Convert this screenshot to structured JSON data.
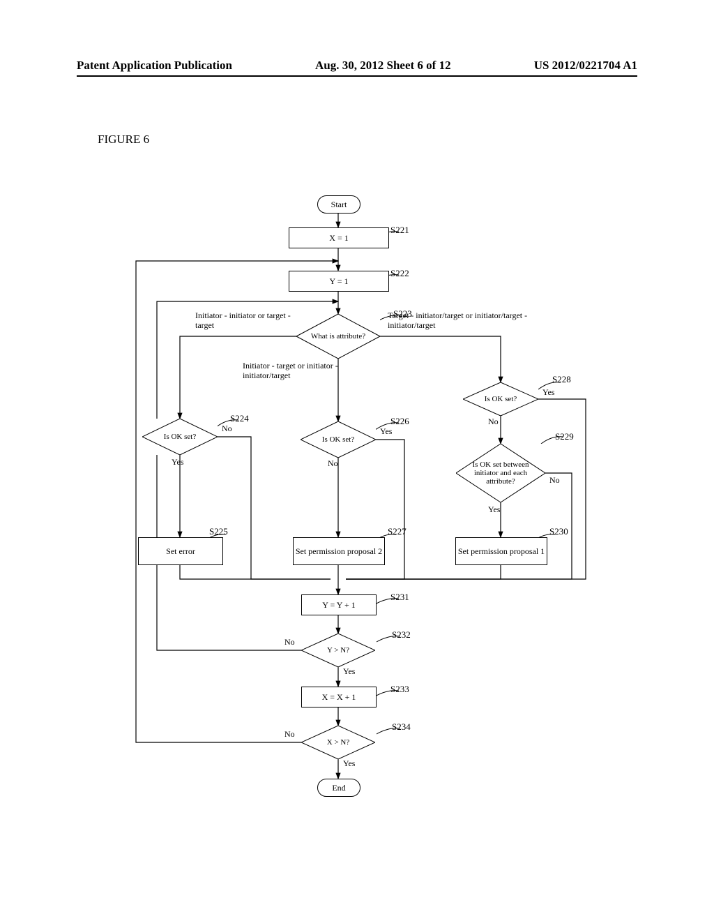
{
  "header": {
    "left": "Patent Application Publication",
    "center": "Aug. 30, 2012  Sheet 6 of 12",
    "right": "US 2012/0221704 A1"
  },
  "figure_label": "FIGURE 6",
  "terminals": {
    "start": "Start",
    "end": "End"
  },
  "processes": {
    "s221": "X = 1",
    "s222": "Y = 1",
    "s225": "Set error",
    "s227": "Set permission proposal 2",
    "s230": "Set permission proposal 1",
    "s231": "Y = Y + 1",
    "s233": "X = X + 1"
  },
  "decisions": {
    "s223": "What is attribute?",
    "s224": "Is OK set?",
    "s226": "Is OK set?",
    "s228": "Is OK set?",
    "s229": "Is OK set between initiator and each attribute?",
    "s232": "Y > N?",
    "s234": "X > N?"
  },
  "step_labels": {
    "s221": "S221",
    "s222": "S222",
    "s223": "S223",
    "s224": "S224",
    "s225": "S225",
    "s226": "S226",
    "s227": "S227",
    "s228": "S228",
    "s229": "S229",
    "s230": "S230",
    "s231": "S231",
    "s232": "S232",
    "s233": "S233",
    "s234": "S234"
  },
  "branch_texts": {
    "s223_left": "Initiator - initiator\nor target - target",
    "s223_right": "Target - initiator/target or\ninitiator/target - initiator/target",
    "s223_down": "Initiator - target or\ninitiator - initiator/target",
    "s224_yes": "Yes",
    "s224_no": "No",
    "s226_yes": "Yes",
    "s226_no": "No",
    "s228_yes": "Yes",
    "s228_no": "No",
    "s229_yes": "Yes",
    "s229_no": "No",
    "s232_yes": "Yes",
    "s232_no": "No",
    "s234_yes": "Yes",
    "s234_no": "No"
  },
  "chart_data": {
    "type": "flowchart",
    "nodes": [
      {
        "id": "start",
        "shape": "terminal",
        "label": "Start"
      },
      {
        "id": "s221",
        "shape": "process",
        "label": "X = 1"
      },
      {
        "id": "s222",
        "shape": "process",
        "label": "Y = 1"
      },
      {
        "id": "s223",
        "shape": "decision",
        "label": "What is attribute?"
      },
      {
        "id": "s224",
        "shape": "decision",
        "label": "Is OK set?"
      },
      {
        "id": "s225",
        "shape": "process",
        "label": "Set error"
      },
      {
        "id": "s226",
        "shape": "decision",
        "label": "Is OK set?"
      },
      {
        "id": "s227",
        "shape": "process",
        "label": "Set permission proposal 2"
      },
      {
        "id": "s228",
        "shape": "decision",
        "label": "Is OK set?"
      },
      {
        "id": "s229",
        "shape": "decision",
        "label": "Is OK set between initiator and each attribute?"
      },
      {
        "id": "s230",
        "shape": "process",
        "label": "Set permission proposal 1"
      },
      {
        "id": "s231",
        "shape": "process",
        "label": "Y = Y + 1"
      },
      {
        "id": "s232",
        "shape": "decision",
        "label": "Y > N?"
      },
      {
        "id": "s233",
        "shape": "process",
        "label": "X = X + 1"
      },
      {
        "id": "s234",
        "shape": "decision",
        "label": "X > N?"
      },
      {
        "id": "end",
        "shape": "terminal",
        "label": "End"
      }
    ],
    "edges": [
      {
        "from": "start",
        "to": "s221"
      },
      {
        "from": "s221",
        "to": "s222"
      },
      {
        "from": "s222",
        "to": "s223"
      },
      {
        "from": "s223",
        "to": "s224",
        "label": "Initiator - initiator or target - target"
      },
      {
        "from": "s223",
        "to": "s226",
        "label": "Initiator - target or initiator - initiator/target"
      },
      {
        "from": "s223",
        "to": "s228",
        "label": "Target - initiator/target or initiator/target - initiator/target"
      },
      {
        "from": "s224",
        "to": "s225",
        "label": "Yes"
      },
      {
        "from": "s224",
        "to": "s231",
        "label": "No"
      },
      {
        "from": "s225",
        "to": "s231"
      },
      {
        "from": "s226",
        "to": "s227",
        "label": "No"
      },
      {
        "from": "s226",
        "to": "s231",
        "label": "Yes"
      },
      {
        "from": "s227",
        "to": "s231"
      },
      {
        "from": "s228",
        "to": "s229",
        "label": "No"
      },
      {
        "from": "s228",
        "to": "s231",
        "label": "Yes"
      },
      {
        "from": "s229",
        "to": "s230",
        "label": "Yes"
      },
      {
        "from": "s229",
        "to": "s231",
        "label": "No"
      },
      {
        "from": "s230",
        "to": "s231"
      },
      {
        "from": "s231",
        "to": "s232"
      },
      {
        "from": "s232",
        "to": "s222",
        "label": "No"
      },
      {
        "from": "s232",
        "to": "s233",
        "label": "Yes"
      },
      {
        "from": "s233",
        "to": "s234"
      },
      {
        "from": "s234",
        "to": "s222",
        "label": "No"
      },
      {
        "from": "s234",
        "to": "end",
        "label": "Yes"
      }
    ]
  }
}
